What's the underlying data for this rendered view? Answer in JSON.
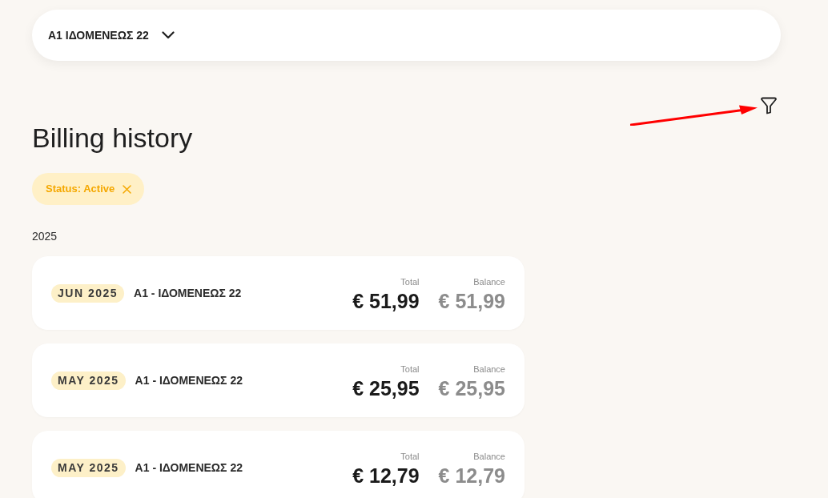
{
  "account_selector": {
    "value": "A1 ΙΔΟΜΕΝΕΩΣ 22"
  },
  "page_title": "Billing history",
  "filters": [
    {
      "label": "Status: Active"
    }
  ],
  "groups": [
    {
      "year": "2025",
      "bills": [
        {
          "period": "JUN 2025",
          "account": "A1 - ΙΔΟΜΕΝΕΩΣ 22",
          "total_label": "Total",
          "total": "€ 51,99",
          "balance_label": "Balance",
          "balance": "€ 51,99"
        },
        {
          "period": "MAY 2025",
          "account": "A1 - ΙΔΟΜΕΝΕΩΣ 22",
          "total_label": "Total",
          "total": "€ 25,95",
          "balance_label": "Balance",
          "balance": "€ 25,95"
        },
        {
          "period": "MAY 2025",
          "account": "A1 - ΙΔΟΜΕΝΕΩΣ 22",
          "total_label": "Total",
          "total": "€ 12,79",
          "balance_label": "Balance",
          "balance": "€ 12,79"
        }
      ]
    }
  ]
}
